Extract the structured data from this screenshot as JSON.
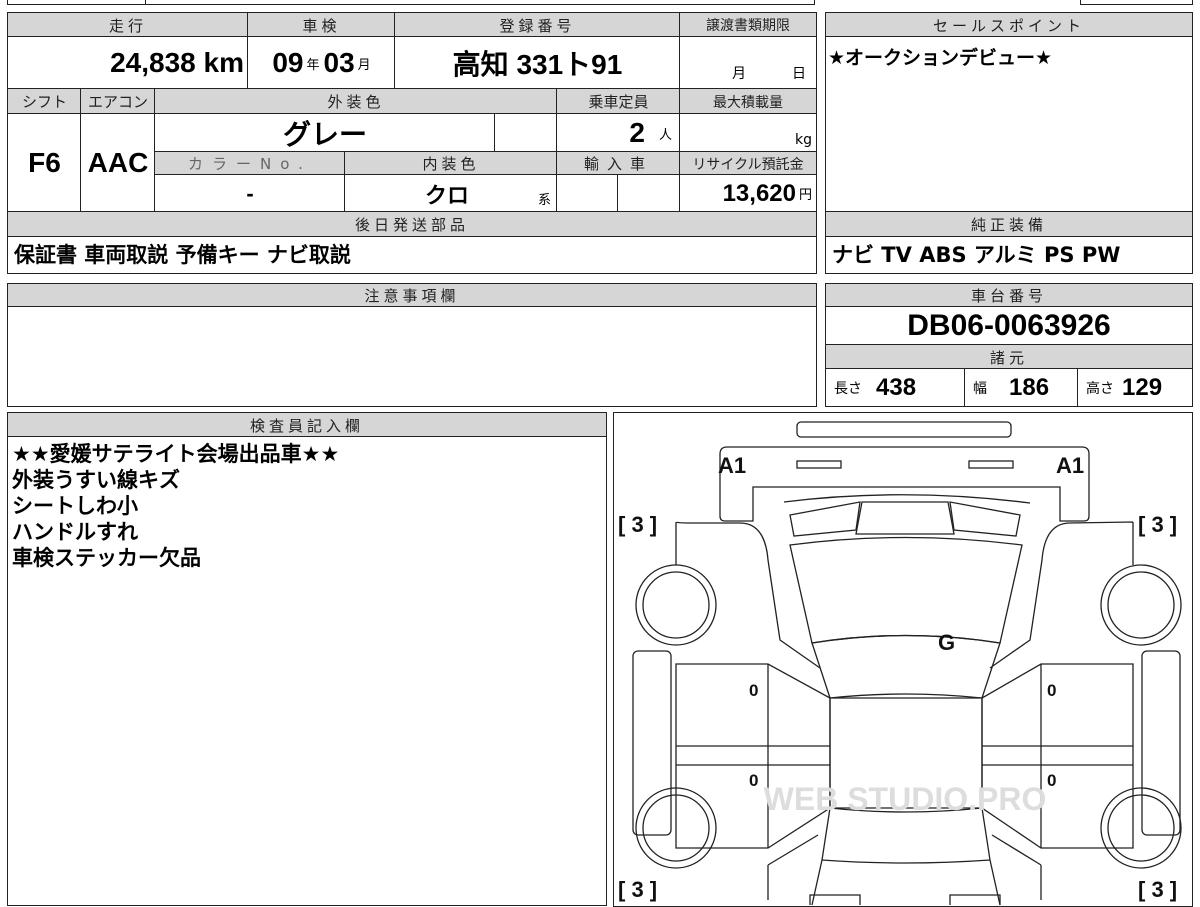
{
  "top_table": {
    "mileage": {
      "label": "走行",
      "value": "24,838",
      "unit": "km"
    },
    "inspection": {
      "label": "車検",
      "year": "09",
      "year_unit": "年",
      "month": "03",
      "month_unit": "月"
    },
    "registration": {
      "label": "登録番号",
      "value": "高知 331ト91"
    },
    "transfer_deadline": {
      "label": "譲渡書類期限",
      "month_unit": "月",
      "day_unit": "日"
    },
    "shift": {
      "label": "シフト",
      "value": "F6"
    },
    "aircon": {
      "label": "エアコン",
      "value": "AAC"
    },
    "exterior_color": {
      "label": "外装色",
      "value": "グレー"
    },
    "capacity": {
      "label": "乗車定員",
      "value": "2",
      "unit": "人"
    },
    "max_load": {
      "label": "最大積載量",
      "unit": "kg"
    },
    "color_no": {
      "label": "カラーNo.",
      "value": "-"
    },
    "interior_color": {
      "label": "内装色",
      "value": "クロ",
      "unit": "系"
    },
    "import": {
      "label": "輸入車"
    },
    "recycle_fee": {
      "label": "リサイクル預託金",
      "value": "13,620",
      "unit": "円"
    },
    "later_items": {
      "label": "後日発送部品",
      "value": "保証書 車両取説 予備キー ナビ取説"
    }
  },
  "sales_point": {
    "label": "セールスポイント",
    "value": "★オークションデビュー★"
  },
  "equipment": {
    "label": "純正装備",
    "value": "ナビ TV ABS アルミ PS PW"
  },
  "notes": {
    "label": "注意事項欄"
  },
  "chassis": {
    "label": "車台番号",
    "value": "DB06-0063926"
  },
  "specs": {
    "label": "諸元",
    "length_label": "長さ",
    "length": "438",
    "width_label": "幅",
    "width": "186",
    "height_label": "高さ",
    "height": "129"
  },
  "inspector": {
    "label": "検査員記入欄",
    "lines": [
      "★★愛媛サテライト会場出品車★★",
      "外装うすい線キズ",
      "シートしわ小",
      "ハンドルすれ",
      "車検ステッカー欠品"
    ]
  },
  "diagram": {
    "marks": {
      "front_left": "A1",
      "front_right": "A1",
      "glass": "G",
      "door_fl": "0",
      "door_fr": "0",
      "door_rl": "0",
      "door_rr": "0"
    },
    "tires": {
      "fl": "[ 3 ]",
      "fr": "[ 3 ]",
      "rl": "[ 3 ]",
      "rr": "[ 3 ]"
    },
    "watermark": "WEB STUDIO.PRO"
  }
}
